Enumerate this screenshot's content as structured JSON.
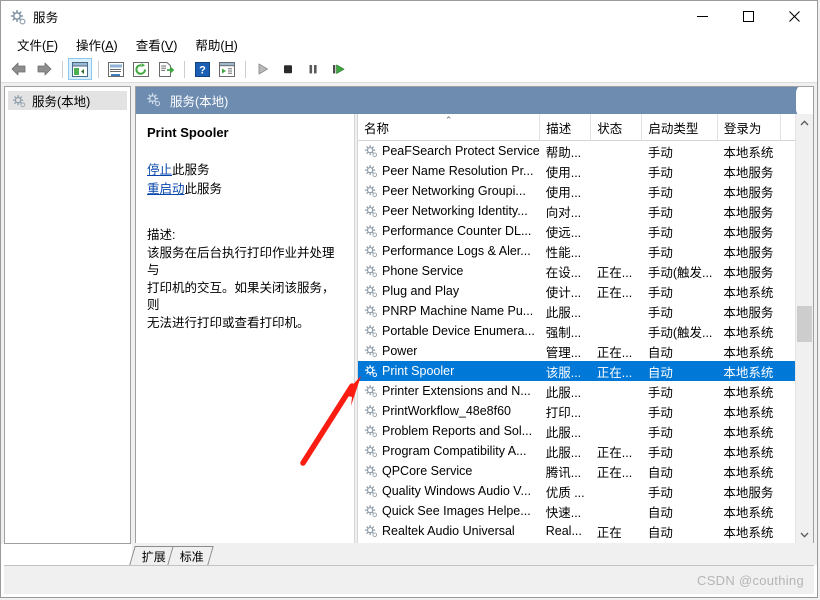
{
  "window": {
    "title": "服务",
    "icon": "services-gear-icon",
    "minimize_label": "–",
    "maximize_label": "□",
    "close_label": "✕"
  },
  "menubar": {
    "items": [
      {
        "name": "menu-file",
        "text": "文件",
        "accel": "F"
      },
      {
        "name": "menu-action",
        "text": "操作",
        "accel": "A"
      },
      {
        "name": "menu-view",
        "text": "查看",
        "accel": "V"
      },
      {
        "name": "menu-help",
        "text": "帮助",
        "accel": "H"
      }
    ]
  },
  "toolbar": {
    "buttons": [
      {
        "name": "back-button",
        "icon": "back-arrow-icon"
      },
      {
        "name": "forward-button",
        "icon": "forward-arrow-icon"
      },
      {
        "name": "show-hide-tree-button",
        "icon": "tree-pane-icon",
        "selected": true
      },
      {
        "name": "properties-button",
        "icon": "properties-icon"
      },
      {
        "name": "refresh-button",
        "icon": "refresh-icon"
      },
      {
        "name": "export-list-button",
        "icon": "export-list-icon"
      },
      {
        "name": "help-button",
        "icon": "question-mark-icon"
      },
      {
        "name": "show-action-pane-button",
        "icon": "action-pane-icon"
      },
      {
        "name": "start-service-button",
        "icon": "play-icon"
      },
      {
        "name": "stop-service-button",
        "icon": "stop-icon"
      },
      {
        "name": "pause-service-button",
        "icon": "pause-icon"
      },
      {
        "name": "restart-service-button",
        "icon": "restart-icon"
      }
    ]
  },
  "tree": {
    "root_label": "服务(本地)",
    "root_icon": "services-gear-icon"
  },
  "content": {
    "header_label": "服务(本地)",
    "header_icon": "services-gear-icon",
    "header_color": "#6d8cb0"
  },
  "detail": {
    "service_name": "Print Spooler",
    "links": [
      {
        "name": "stop-service-link",
        "action": "停止",
        "suffix": "此服务"
      },
      {
        "name": "restart-service-link",
        "action": "重启动",
        "suffix": "此服务"
      }
    ],
    "description_label": "描述:",
    "description_lines": [
      "该服务在后台执行打印作业并处理与",
      "打印机的交互。如果关闭该服务，则",
      "无法进行打印或查看打印机。"
    ]
  },
  "list": {
    "columns": [
      {
        "key": "name",
        "label": "名称",
        "width": 178,
        "sorted": "asc"
      },
      {
        "key": "desc",
        "label": "描述",
        "width": 50
      },
      {
        "key": "status",
        "label": "状态",
        "width": 50
      },
      {
        "key": "startup",
        "label": "启动类型",
        "width": 74
      },
      {
        "key": "logon",
        "label": "登录为",
        "width": 62
      },
      {
        "key": "spare",
        "label": "",
        "width": 14
      }
    ],
    "rows": [
      {
        "name": "PeaFSearch Protect Service",
        "desc": "帮助...",
        "status": "",
        "startup": "手动",
        "logon": "本地系统",
        "selected": false
      },
      {
        "name": "Peer Name Resolution Pr...",
        "desc": "使用...",
        "status": "",
        "startup": "手动",
        "logon": "本地服务",
        "selected": false
      },
      {
        "name": "Peer Networking Groupi...",
        "desc": "使用...",
        "status": "",
        "startup": "手动",
        "logon": "本地服务",
        "selected": false
      },
      {
        "name": "Peer Networking Identity...",
        "desc": "向对...",
        "status": "",
        "startup": "手动",
        "logon": "本地服务",
        "selected": false
      },
      {
        "name": "Performance Counter DL...",
        "desc": "使远...",
        "status": "",
        "startup": "手动",
        "logon": "本地服务",
        "selected": false
      },
      {
        "name": "Performance Logs & Aler...",
        "desc": "性能...",
        "status": "",
        "startup": "手动",
        "logon": "本地服务",
        "selected": false
      },
      {
        "name": "Phone Service",
        "desc": "在设...",
        "status": "正在...",
        "startup": "手动(触发...",
        "logon": "本地服务",
        "selected": false
      },
      {
        "name": "Plug and Play",
        "desc": "使计...",
        "status": "正在...",
        "startup": "手动",
        "logon": "本地系统",
        "selected": false
      },
      {
        "name": "PNRP Machine Name Pu...",
        "desc": "此服...",
        "status": "",
        "startup": "手动",
        "logon": "本地服务",
        "selected": false
      },
      {
        "name": "Portable Device Enumera...",
        "desc": "强制...",
        "status": "",
        "startup": "手动(触发...",
        "logon": "本地系统",
        "selected": false
      },
      {
        "name": "Power",
        "desc": "管理...",
        "status": "正在...",
        "startup": "自动",
        "logon": "本地系统",
        "selected": false
      },
      {
        "name": "Print Spooler",
        "desc": "该服...",
        "status": "正在...",
        "startup": "自动",
        "logon": "本地系统",
        "selected": true
      },
      {
        "name": "Printer Extensions and N...",
        "desc": "此服...",
        "status": "",
        "startup": "手动",
        "logon": "本地系统",
        "selected": false
      },
      {
        "name": "PrintWorkflow_48e8f60",
        "desc": "打印...",
        "status": "",
        "startup": "手动",
        "logon": "本地系统",
        "selected": false
      },
      {
        "name": "Problem Reports and Sol...",
        "desc": "此服...",
        "status": "",
        "startup": "手动",
        "logon": "本地系统",
        "selected": false
      },
      {
        "name": "Program Compatibility A...",
        "desc": "此服...",
        "status": "正在...",
        "startup": "手动",
        "logon": "本地系统",
        "selected": false
      },
      {
        "name": "QPCore Service",
        "desc": "腾讯...",
        "status": "正在...",
        "startup": "自动",
        "logon": "本地系统",
        "selected": false
      },
      {
        "name": "Quality Windows Audio V...",
        "desc": "优质 ...",
        "status": "",
        "startup": "手动",
        "logon": "本地服务",
        "selected": false
      },
      {
        "name": "Quick See Images Helpe...",
        "desc": "快速...",
        "status": "",
        "startup": "自动",
        "logon": "本地系统",
        "selected": false
      },
      {
        "name": "Realtek Audio Universal",
        "desc": "Real...",
        "status": "正在",
        "startup": "自动",
        "logon": "本地系统",
        "selected": false
      }
    ],
    "scroll_up_icon": "chevron-up-icon",
    "scroll_down_icon": "chevron-down-icon"
  },
  "tabs": [
    {
      "name": "tab-extended",
      "label": "扩展",
      "active": true
    },
    {
      "name": "tab-standard",
      "label": "标准",
      "active": false
    }
  ],
  "statusbar": {
    "watermark": "CSDN @couthing"
  },
  "annotation": {
    "arrow_color": "#fc1d12"
  }
}
